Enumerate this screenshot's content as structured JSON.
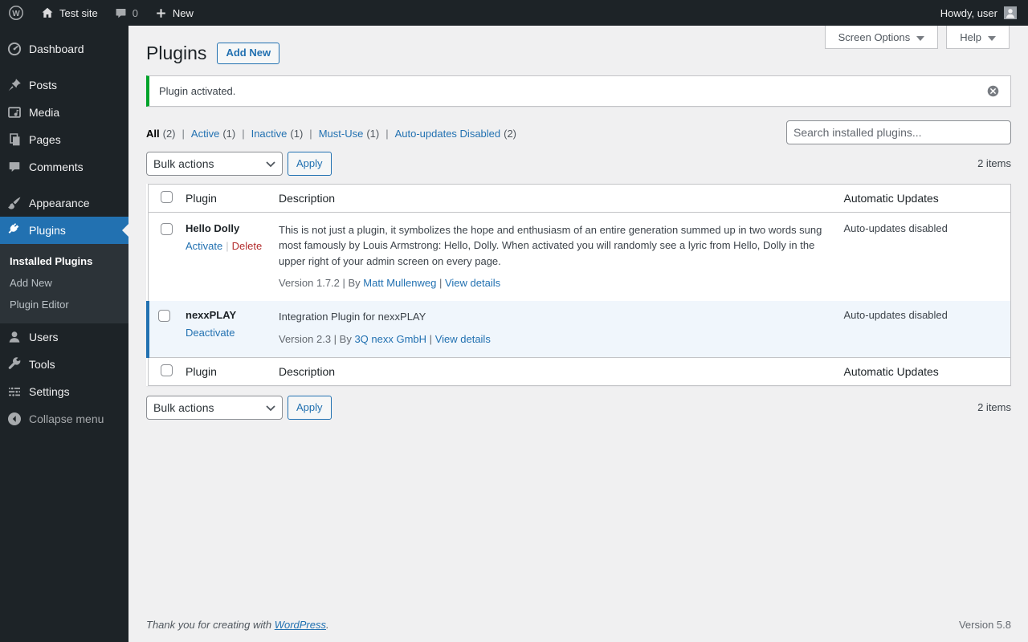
{
  "admin_bar": {
    "site_name": "Test site",
    "comment_count": "0",
    "new_label": "New",
    "howdy": "Howdy, user"
  },
  "sidebar": {
    "items": [
      {
        "label": "Dashboard",
        "icon": "dashboard-icon"
      },
      {
        "label": "Posts",
        "icon": "pushpin-icon"
      },
      {
        "label": "Media",
        "icon": "media-icon"
      },
      {
        "label": "Pages",
        "icon": "pages-icon"
      },
      {
        "label": "Comments",
        "icon": "comments-icon"
      },
      {
        "label": "Appearance",
        "icon": "appearance-icon"
      },
      {
        "label": "Plugins",
        "icon": "plugin-icon",
        "active": true
      },
      {
        "label": "Users",
        "icon": "users-icon"
      },
      {
        "label": "Tools",
        "icon": "tools-icon"
      },
      {
        "label": "Settings",
        "icon": "settings-icon"
      },
      {
        "label": "Collapse menu",
        "icon": "collapse-icon"
      }
    ],
    "plugins_submenu": [
      {
        "label": "Installed Plugins",
        "current": true
      },
      {
        "label": "Add New"
      },
      {
        "label": "Plugin Editor"
      }
    ]
  },
  "header": {
    "title": "Plugins",
    "add_new_label": "Add New",
    "screen_options_label": "Screen Options",
    "help_label": "Help"
  },
  "notice": {
    "message": "Plugin activated."
  },
  "filters": {
    "items": [
      {
        "label": "All",
        "count": "(2)",
        "current": true
      },
      {
        "label": "Active",
        "count": "(1)"
      },
      {
        "label": "Inactive",
        "count": "(1)"
      },
      {
        "label": "Must-Use",
        "count": "(1)"
      },
      {
        "label": "Auto-updates Disabled",
        "count": "(2)"
      }
    ]
  },
  "search": {
    "placeholder": "Search installed plugins..."
  },
  "tablenav": {
    "bulk_actions_label": "Bulk actions",
    "apply_label": "Apply",
    "items_count": "2 items"
  },
  "table": {
    "headers": {
      "plugin": "Plugin",
      "description": "Description",
      "auto_updates": "Automatic Updates"
    },
    "rows": [
      {
        "name": "Hello Dolly",
        "action1": "Activate",
        "action2": "Delete",
        "description": "This is not just a plugin, it symbolizes the hope and enthusiasm of an entire generation summed up in two words sung most famously by Louis Armstrong: Hello, Dolly. When activated you will randomly see a lyric from Hello, Dolly in the upper right of your admin screen on every page.",
        "version_by": "Version 1.7.2 | By",
        "author": "Matt Mullenweg",
        "view_details": "View details",
        "auto_updates": "Auto-updates disabled"
      },
      {
        "name": "nexxPLAY",
        "action1": "Deactivate",
        "description": "Integration Plugin for nexxPLAY",
        "version_by": "Version 2.3 | By",
        "author": "3Q nexx GmbH",
        "view_details": "View details",
        "auto_updates": "Auto-updates disabled"
      }
    ]
  },
  "footer": {
    "thanks_prefix": "Thank you for creating with",
    "wordpress_link": "WordPress",
    "thanks_suffix": ".",
    "version": "Version 5.8"
  },
  "ui": {
    "pipe": "|"
  },
  "colors": {
    "accent": "#2271b1",
    "notice_green": "#00a32a",
    "delete_red": "#b32d2e",
    "active_row_bg": "#f0f6fc",
    "sidebar_bg": "#1d2327",
    "submenu_bg": "#2c3338",
    "content_bg": "#f0f0f1"
  }
}
